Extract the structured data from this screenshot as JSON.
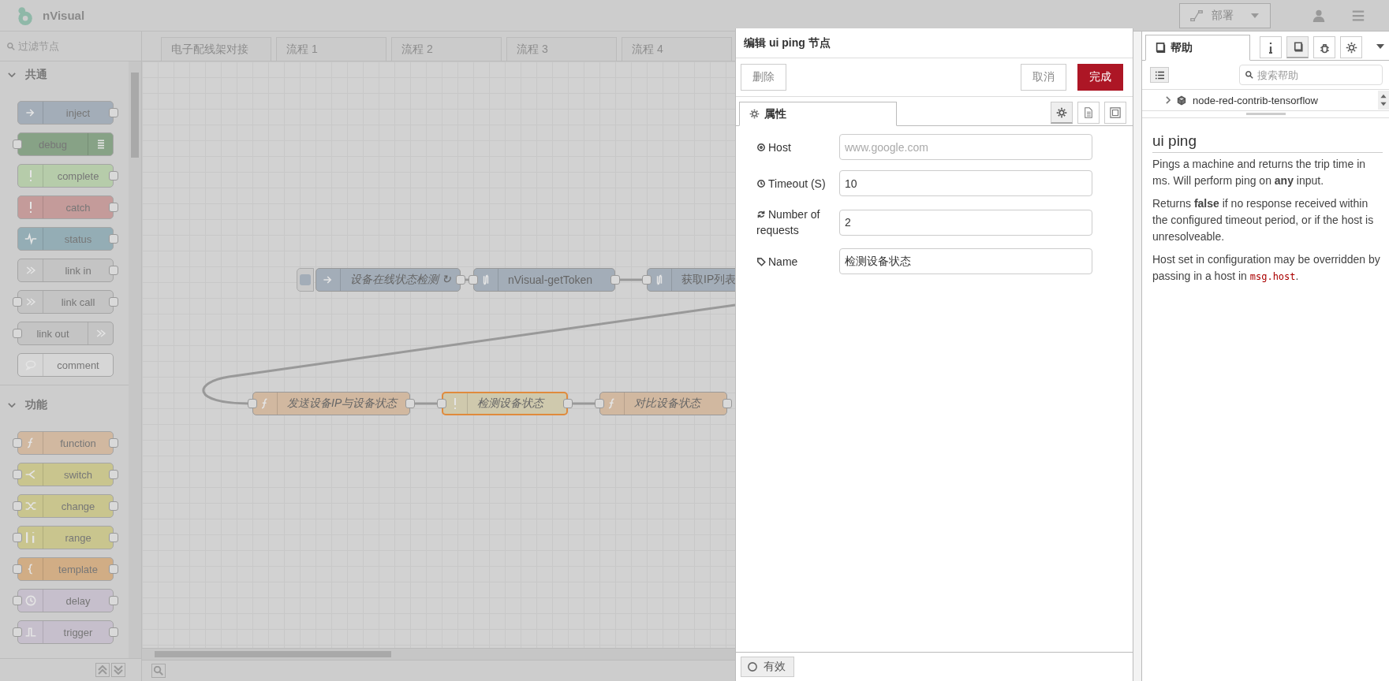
{
  "header": {
    "logo_text": "nVisual",
    "deploy_label": "部署"
  },
  "palette": {
    "filter_placeholder": "过滤节点",
    "categories": [
      {
        "label": "共通",
        "expanded": true,
        "nodes": [
          {
            "label": "inject",
            "color": "#a3adb8",
            "icon_right": false
          },
          {
            "label": "debug",
            "color": "#87a286",
            "icon_right": true
          },
          {
            "label": "complete",
            "color": "#b6ccaa",
            "icon_right": false
          },
          {
            "label": "catch",
            "color": "#c49b9a",
            "icon_right": false
          },
          {
            "label": "status",
            "color": "#94adb5",
            "icon_right": false
          },
          {
            "label": "link in",
            "color": "#c4c4c4",
            "icon_right": false
          },
          {
            "label": "link call",
            "color": "#c4c4c4",
            "icon_right": false
          },
          {
            "label": "link out",
            "color": "#c4c4c4",
            "icon_right": true
          },
          {
            "label": "comment",
            "color": "#d6d6d6",
            "icon_right": false
          }
        ]
      },
      {
        "label": "功能",
        "expanded": true,
        "nodes": [
          {
            "label": "function",
            "color": "#d1b8a0",
            "icon_right": false
          },
          {
            "label": "switch",
            "color": "#c9c58e",
            "icon_right": false
          },
          {
            "label": "change",
            "color": "#c9c58e",
            "icon_right": false
          },
          {
            "label": "range",
            "color": "#c9c58e",
            "icon_right": false
          },
          {
            "label": "template",
            "color": "#d1ad85",
            "icon_right": false
          },
          {
            "label": "delay",
            "color": "#c6bfcc",
            "icon_right": false
          },
          {
            "label": "trigger",
            "color": "#c6bfcc",
            "icon_right": false
          }
        ]
      }
    ]
  },
  "workspace": {
    "tabs": [
      "电子配线架对接",
      "流程 1",
      "流程 2",
      "流程 3",
      "流程 4"
    ],
    "nodes": [
      {
        "label": "设备在线状态检测 ↻",
        "color": "#a3adb8",
        "button": true,
        "italic": true,
        "selected": false
      },
      {
        "label": "nVisual-getToken",
        "color": "#a3adb8",
        "button": false,
        "italic": false,
        "selected": false
      },
      {
        "label": "获取IP列表",
        "color": "#a3adb8",
        "button": false,
        "italic": false,
        "selected": false
      },
      {
        "label": "发送设备IP与设备状态",
        "color": "#d1b8a0",
        "button": false,
        "italic": true,
        "selected": false
      },
      {
        "label": "检测设备状态",
        "color": "#cfc9ad",
        "button": false,
        "italic": true,
        "selected": true
      },
      {
        "label": "对比设备状态",
        "color": "#d1b8a0",
        "button": false,
        "italic": true,
        "selected": false
      }
    ]
  },
  "editor": {
    "title": "编辑 ui ping 节点",
    "delete_label": "删除",
    "cancel_label": "取消",
    "done_label": "完成",
    "tab_label": "属性",
    "fields": [
      {
        "label": "Host",
        "placeholder": "www.google.com"
      },
      {
        "label": "Timeout (S)",
        "value": "10"
      },
      {
        "label": "Number of requests",
        "value": "2"
      },
      {
        "label": "Name",
        "value": "检测设备状态"
      }
    ],
    "enabled_label": "有效"
  },
  "sidebar": {
    "tab_label": "帮助",
    "icon_tabs": [
      {
        "selected": false
      },
      {
        "selected": true
      },
      {
        "selected": false
      },
      {
        "selected": false
      }
    ],
    "search_placeholder": "搜索帮助",
    "tree_item": {
      "label": "node-red-contrib-tensorflow",
      "expanded": false
    },
    "help": {
      "title": "ui ping",
      "paragraphs": [
        {
          "text": "Pings a machine and returns the trip time in ms. Will perform ping on **any** input."
        },
        {
          "text": "Returns **false** if no response received within the configured timeout period, or if the host is unresolveable."
        },
        {
          "text": "Host set in configuration may be overridden by passing in a host in ",
          "code": "msg.host",
          "after": "."
        }
      ]
    }
  }
}
